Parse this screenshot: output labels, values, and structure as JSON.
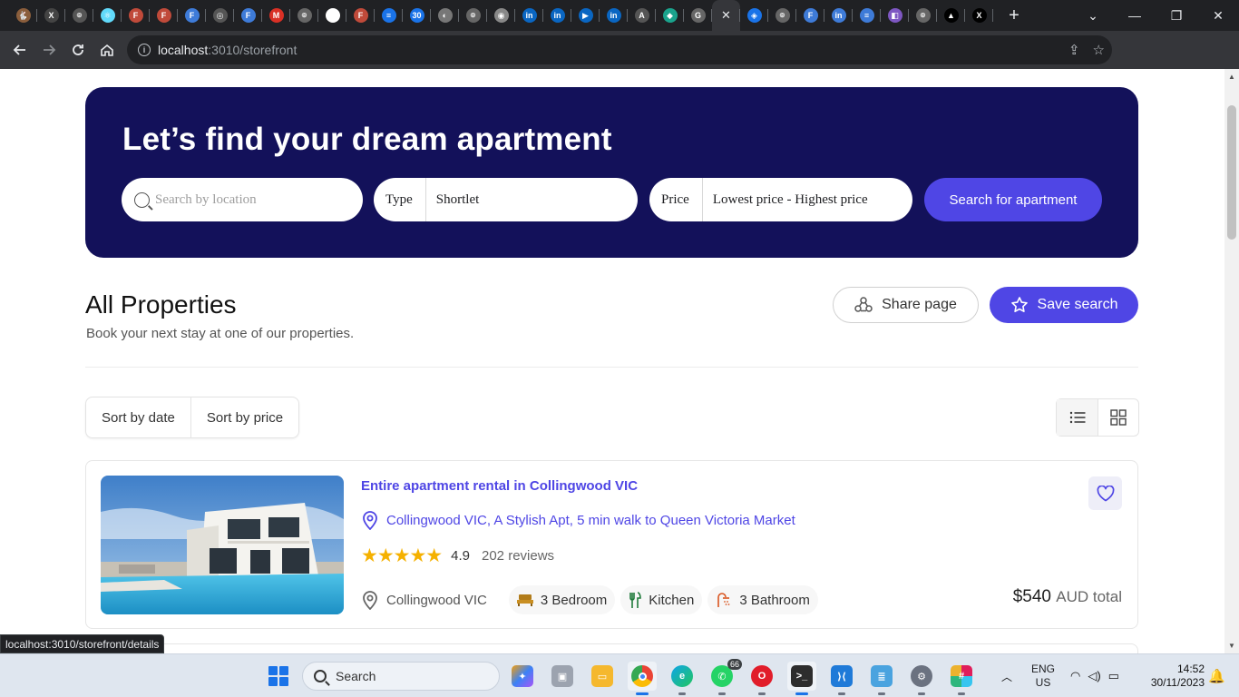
{
  "browser": {
    "tab_close_glyph": "✕",
    "new_tab_glyph": "+",
    "url_host": "localhost",
    "url_path": ":3010/storefront",
    "status_url": "localhost:3010/storefront/details",
    "favicons": [
      {
        "name": "rabbit-icon",
        "color": "#8b5e3c",
        "glyph": "🐇"
      },
      {
        "name": "x-icon",
        "color": "#444",
        "glyph": "X"
      },
      {
        "name": "github-icon",
        "color": "#555",
        "glyph": "⌾"
      },
      {
        "name": "react-icon",
        "color": "#61dafb",
        "glyph": "⚛"
      },
      {
        "name": "figma-icon",
        "color": "#c04a3a",
        "glyph": "F"
      },
      {
        "name": "figma-icon",
        "color": "#c04a3a",
        "glyph": "F"
      },
      {
        "name": "figma-icon",
        "color": "#3e7bd8",
        "glyph": "F"
      },
      {
        "name": "globe-icon",
        "color": "#555",
        "glyph": "◎"
      },
      {
        "name": "figma-icon",
        "color": "#3e7bd8",
        "glyph": "F"
      },
      {
        "name": "gmail-icon",
        "color": "#d93025",
        "glyph": "M"
      },
      {
        "name": "github-icon",
        "color": "#666",
        "glyph": "⌾"
      },
      {
        "name": "github-icon",
        "color": "#fff",
        "glyph": "⌾"
      },
      {
        "name": "figma-icon",
        "color": "#c04a3a",
        "glyph": "F"
      },
      {
        "name": "docs-icon",
        "color": "#1a73e8",
        "glyph": "≡"
      },
      {
        "name": "calendar-icon",
        "color": "#1a73e8",
        "glyph": "30"
      },
      {
        "name": "globe-icon",
        "color": "#777",
        "glyph": "◐"
      },
      {
        "name": "github-icon",
        "color": "#666",
        "glyph": "⌾"
      },
      {
        "name": "chrome-icon",
        "color": "#888",
        "glyph": "◉"
      },
      {
        "name": "linkedin-icon",
        "color": "#0a66c2",
        "glyph": "in"
      },
      {
        "name": "linkedin-icon",
        "color": "#0a66c2",
        "glyph": "in"
      },
      {
        "name": "video-icon",
        "color": "#0a66c2",
        "glyph": "▶"
      },
      {
        "name": "linkedin-icon",
        "color": "#0a66c2",
        "glyph": "in"
      },
      {
        "name": "aria-icon",
        "color": "#555",
        "glyph": "A"
      },
      {
        "name": "diamond-icon",
        "color": "#1aa38c",
        "glyph": "◆"
      },
      {
        "name": "refresh-icon",
        "color": "#666",
        "glyph": "G"
      },
      {
        "name": "close-icon",
        "color": "#35363a",
        "glyph": "✕"
      },
      {
        "name": "diamond-icon",
        "color": "#1a73e8",
        "glyph": "◈"
      },
      {
        "name": "github-icon",
        "color": "#666",
        "glyph": "⌾"
      },
      {
        "name": "figma-icon",
        "color": "#3e7bd8",
        "glyph": "F"
      },
      {
        "name": "linkedin-icon",
        "color": "#3e7bd8",
        "glyph": "in"
      },
      {
        "name": "docs-icon",
        "color": "#3e7bd8",
        "glyph": "≡"
      },
      {
        "name": "purple-app-icon",
        "color": "#7e57c2",
        "glyph": "◧"
      },
      {
        "name": "github-icon",
        "color": "#666",
        "glyph": "⌾"
      },
      {
        "name": "triangle-icon",
        "color": "#000",
        "glyph": "▲"
      },
      {
        "name": "x-icon",
        "color": "#000",
        "glyph": "X"
      }
    ]
  },
  "hero": {
    "title": "Let’s find your dream apartment",
    "location_placeholder": "Search by location",
    "type_label": "Type",
    "type_value": "Shortlet",
    "price_label": "Price",
    "price_value": "Lowest price - Highest price",
    "search_button": "Search for apartment"
  },
  "section": {
    "title": "All Properties",
    "subtitle": "Book your next stay at one of our properties.",
    "share_label": "Share page",
    "save_label": "Save search"
  },
  "sort": {
    "by_date": "Sort by date",
    "by_price": "Sort by price"
  },
  "listing": {
    "title": "Entire apartment rental in Collingwood VIC",
    "address": "Collingwood VIC, A Stylish Apt, 5 min walk to Queen Victoria Market",
    "stars": "★★★★★",
    "rating": "4.9",
    "reviews": "202 reviews",
    "location": "Collingwood VIC",
    "bedroom": "3 Bedroom",
    "kitchen": "Kitchen",
    "bathroom": "3 Bathroom",
    "price": "$540",
    "price_suffix": "AUD total"
  },
  "taskbar": {
    "search_label": "Search",
    "whatsapp_badge": "66",
    "lang_line1": "ENG",
    "lang_line2": "US",
    "time": "14:52",
    "date": "30/11/2023"
  },
  "colors": {
    "hero_bg": "#13115a",
    "accent": "#4f46e5",
    "star": "#f5b100"
  }
}
